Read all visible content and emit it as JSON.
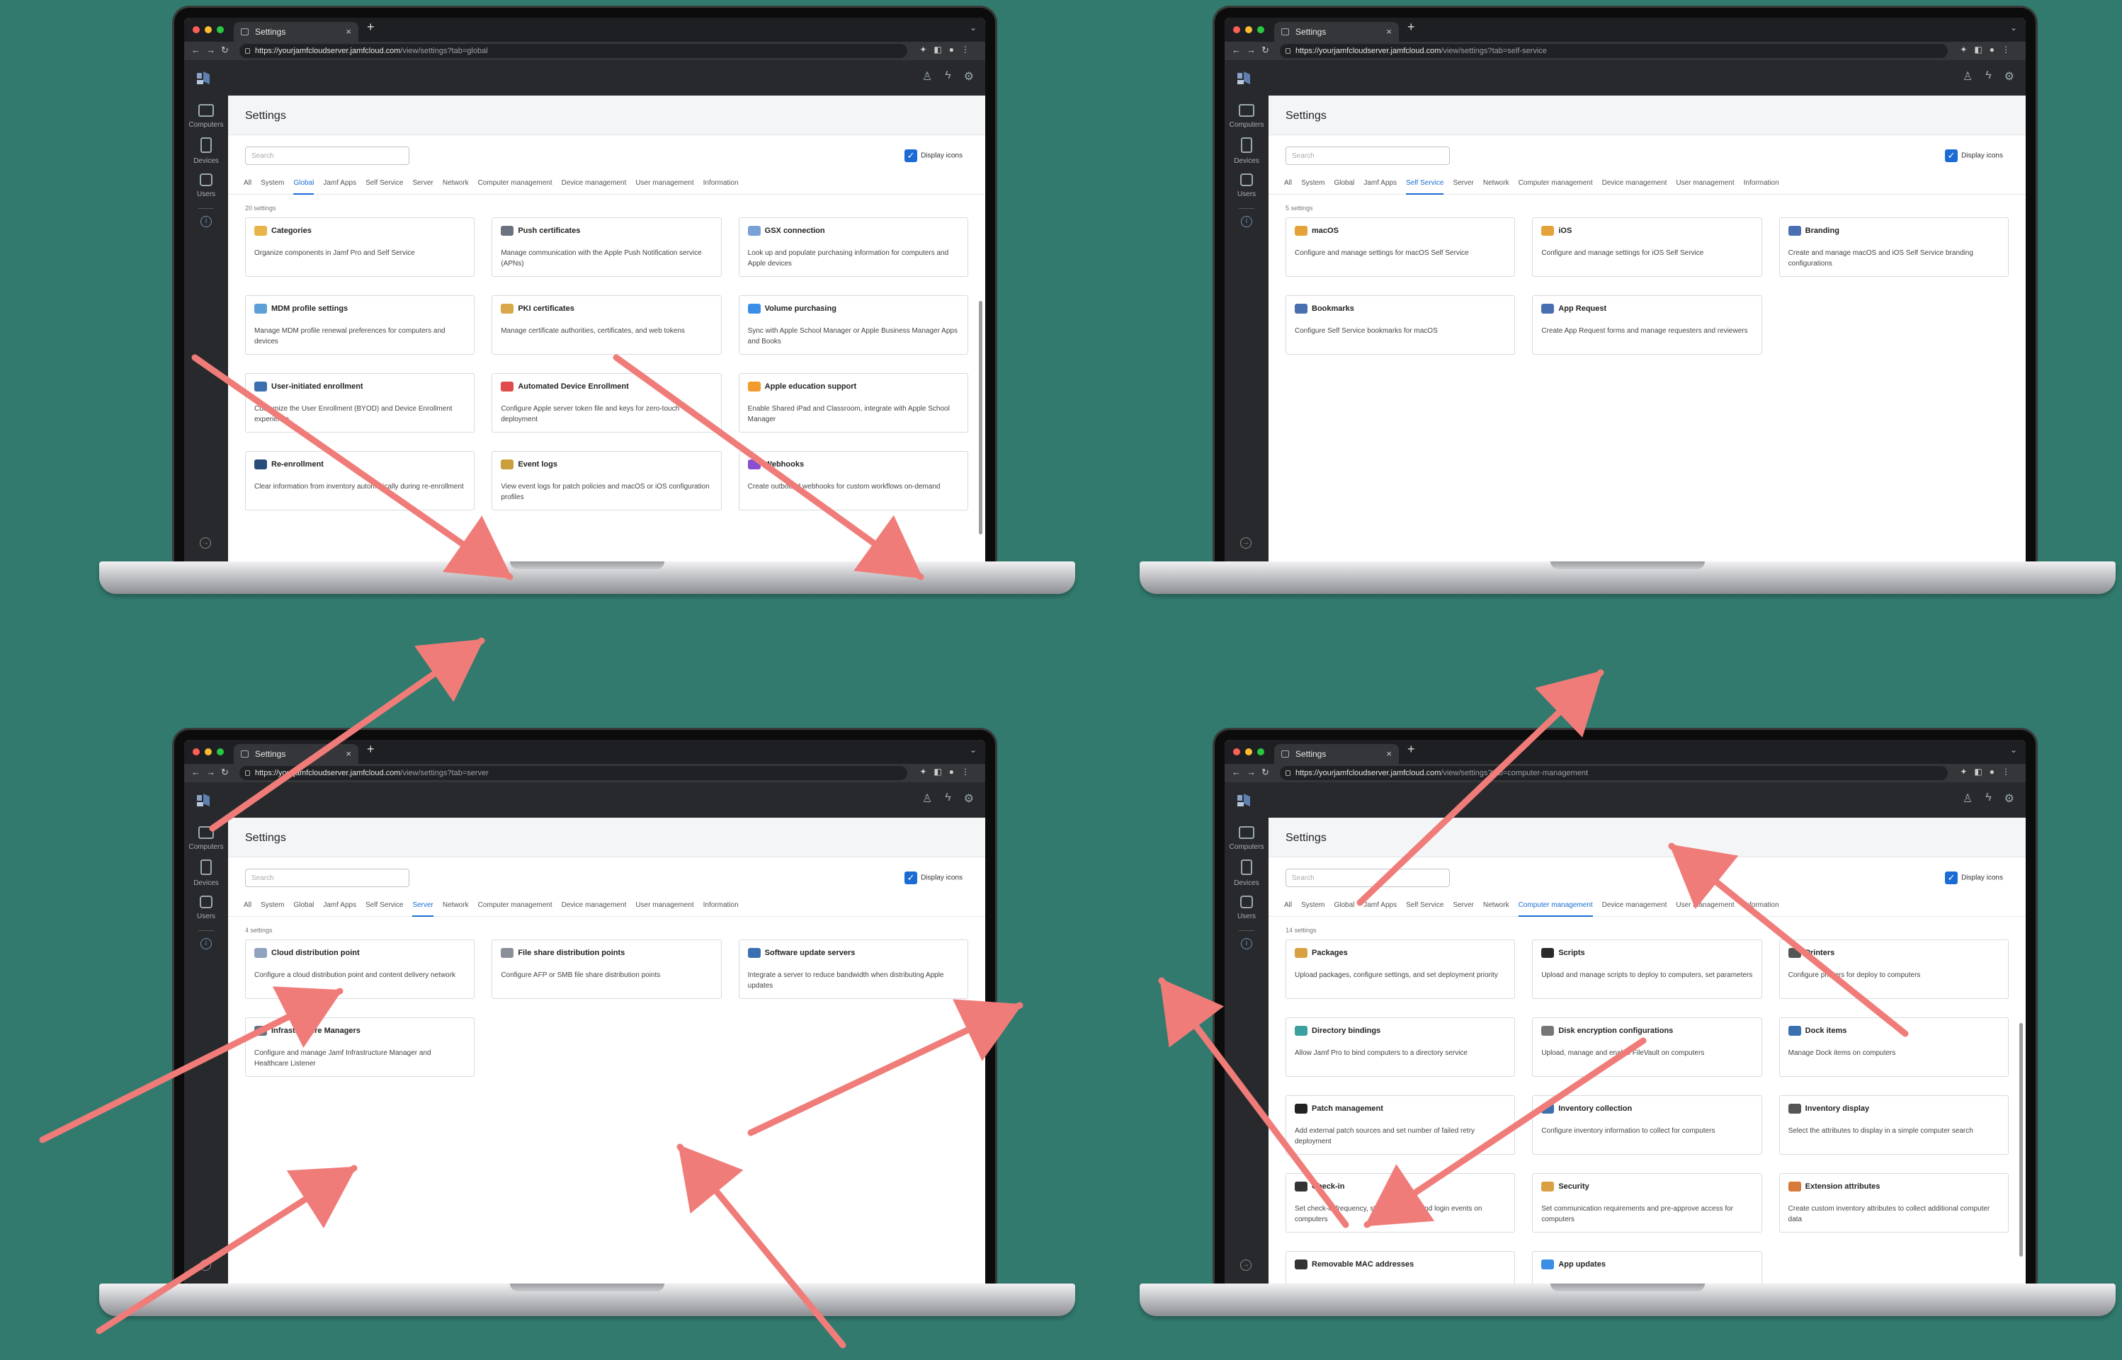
{
  "colors": {
    "background": "#327a6e",
    "accent": "#1a6cd3",
    "arrow": "#f07c79"
  },
  "screens": [
    {
      "id": "tl",
      "browser": {
        "tab_title": "Settings",
        "url_host": "https://yourjamfcloudserver.jamfcloud.com",
        "url_path": "/view/settings?tab=global"
      },
      "page_title": "Settings",
      "search_placeholder": "Search",
      "display_icons_label": "Display icons",
      "tabs": [
        "All",
        "System",
        "Global",
        "Jamf Apps",
        "Self Service",
        "Server",
        "Network",
        "Computer management",
        "Device management",
        "User management",
        "Information"
      ],
      "active_tab": "Global",
      "count": "20 settings",
      "cards": [
        {
          "title": "Categories",
          "desc": "Organize components in Jamf Pro and Self Service",
          "icon": "folder-icon",
          "color": "#e8b449"
        },
        {
          "title": "Push certificates",
          "desc": "Manage communication with the Apple Push Notification service (APNs)",
          "icon": "push-certificate-icon",
          "color": "#6b7280"
        },
        {
          "title": "GSX connection",
          "desc": "Look up and populate purchasing information for computers and Apple devices",
          "icon": "gsx-icon",
          "color": "#7aa0d8"
        },
        {
          "title": "MDM profile settings",
          "desc": "Manage MDM profile renewal preferences for computers and devices",
          "icon": "mdm-profile-icon",
          "color": "#5da0d8"
        },
        {
          "title": "PKI certificates",
          "desc": "Manage certificate authorities, certificates, and web tokens",
          "icon": "certificate-icon",
          "color": "#d8a84a"
        },
        {
          "title": "Volume purchasing",
          "desc": "Sync with Apple School Manager or Apple Business Manager Apps and Books",
          "icon": "app-store-icon",
          "color": "#3a8ee6"
        },
        {
          "title": "User-initiated enrollment",
          "desc": "Customize the User Enrollment (BYOD) and Device Enrollment experience",
          "icon": "enrollment-icon",
          "color": "#3a6fb0"
        },
        {
          "title": "Automated Device Enrollment",
          "desc": "Configure Apple server token file and keys for zero-touch deployment",
          "icon": "device-enrollment-icon",
          "color": "#e04b4b"
        },
        {
          "title": "Apple education support",
          "desc": "Enable Shared iPad and Classroom, integrate with Apple School Manager",
          "icon": "education-icon",
          "color": "#f29a2e"
        },
        {
          "title": "Re-enrollment",
          "desc": "Clear information from inventory automatically during re-enrollment",
          "icon": "re-enrollment-icon",
          "color": "#2a4c7a"
        },
        {
          "title": "Event logs",
          "desc": "View event logs for patch policies and macOS or iOS configuration profiles",
          "icon": "event-log-icon",
          "color": "#c99e3b"
        },
        {
          "title": "Webhooks",
          "desc": "Create outbound webhooks for custom workflows on-demand",
          "icon": "webhook-icon",
          "color": "#8a4fd0"
        }
      ]
    },
    {
      "id": "tr",
      "browser": {
        "tab_title": "Settings",
        "url_host": "https://yourjamfcloudserver.jamfcloud.com",
        "url_path": "/view/settings?tab=self-service"
      },
      "page_title": "Settings",
      "search_placeholder": "Search",
      "display_icons_label": "Display icons",
      "tabs": [
        "All",
        "System",
        "Global",
        "Jamf Apps",
        "Self Service",
        "Server",
        "Network",
        "Computer management",
        "Device management",
        "User management",
        "Information"
      ],
      "active_tab": "Self Service",
      "count": "5 settings",
      "cards": [
        {
          "title": "macOS",
          "desc": "Configure and manage settings for macOS Self Service",
          "icon": "macos-self-service-icon",
          "color": "#e6a23a"
        },
        {
          "title": "iOS",
          "desc": "Configure and manage settings for iOS Self Service",
          "icon": "ios-self-service-icon",
          "color": "#e6a23a"
        },
        {
          "title": "Branding",
          "desc": "Create and manage macOS and iOS Self Service branding configurations",
          "icon": "branding-icon",
          "color": "#4a6fb0"
        },
        {
          "title": "Bookmarks",
          "desc": "Configure Self Service bookmarks for macOS",
          "icon": "bookmark-icon",
          "color": "#4a6fb0"
        },
        {
          "title": "App Request",
          "desc": "Create App Request forms and manage requesters and reviewers",
          "icon": "app-request-icon",
          "color": "#4a6fb0"
        }
      ]
    },
    {
      "id": "bl",
      "browser": {
        "tab_title": "Settings",
        "url_host": "https://yourjamfcloudserver.jamfcloud.com",
        "url_path": "/view/settings?tab=server"
      },
      "page_title": "Settings",
      "search_placeholder": "Search",
      "display_icons_label": "Display icons",
      "tabs": [
        "All",
        "System",
        "Global",
        "Jamf Apps",
        "Self Service",
        "Server",
        "Network",
        "Computer management",
        "Device management",
        "User management",
        "Information"
      ],
      "active_tab": "Server",
      "count": "4 settings",
      "cards": [
        {
          "title": "Cloud distribution point",
          "desc": "Configure a cloud distribution point and content delivery network",
          "icon": "cloud-icon",
          "color": "#8fa3bf"
        },
        {
          "title": "File share distribution points",
          "desc": "Configure AFP or SMB file share distribution points",
          "icon": "file-share-icon",
          "color": "#8a8f99"
        },
        {
          "title": "Software update servers",
          "desc": "Integrate a server to reduce bandwidth when distributing Apple updates",
          "icon": "software-update-icon",
          "color": "#3a6fb0"
        },
        {
          "title": "Infrastructure Managers",
          "desc": "Configure and manage Jamf Infrastructure Manager and Healthcare Listener",
          "icon": "infrastructure-icon",
          "color": "#6b7280"
        }
      ]
    },
    {
      "id": "br",
      "browser": {
        "tab_title": "Settings",
        "url_host": "https://yourjamfcloudserver.jamfcloud.com",
        "url_path": "/view/settings?tab=computer-management"
      },
      "page_title": "Settings",
      "search_placeholder": "Search",
      "display_icons_label": "Display icons",
      "tabs": [
        "All",
        "System",
        "Global",
        "Jamf Apps",
        "Self Service",
        "Server",
        "Network",
        "Computer management",
        "Device management",
        "User management",
        "Information"
      ],
      "active_tab": "Computer management",
      "count": "14 settings",
      "cards": [
        {
          "title": "Packages",
          "desc": "Upload packages, configure settings, and set deployment priority",
          "icon": "package-icon",
          "color": "#d8a040"
        },
        {
          "title": "Scripts",
          "desc": "Upload and manage scripts to deploy to computers, set parameters",
          "icon": "script-icon",
          "color": "#2a2a2a"
        },
        {
          "title": "Printers",
          "desc": "Configure printers for deploy to computers",
          "icon": "printer-icon",
          "color": "#555"
        },
        {
          "title": "Directory bindings",
          "desc": "Allow Jamf Pro to bind computers to a directory service",
          "icon": "directory-icon",
          "color": "#3aa0a0"
        },
        {
          "title": "Disk encryption configurations",
          "desc": "Upload, manage and enable FileVault on computers",
          "icon": "disk-encryption-icon",
          "color": "#777"
        },
        {
          "title": "Dock items",
          "desc": "Manage Dock items on computers",
          "icon": "dock-icon",
          "color": "#3a6fb0"
        },
        {
          "title": "Patch management",
          "desc": "Add external patch sources and set number of failed retry deployment",
          "icon": "patch-icon",
          "color": "#222"
        },
        {
          "title": "Inventory collection",
          "desc": "Configure inventory information to collect for computers",
          "icon": "inventory-collection-icon",
          "color": "#3a6fb0"
        },
        {
          "title": "Inventory display",
          "desc": "Select the attributes to display in a simple computer search",
          "icon": "inventory-display-icon",
          "color": "#555"
        },
        {
          "title": "Check-in",
          "desc": "Set check-in frequency, startup options, and login events on computers",
          "icon": "check-in-icon",
          "color": "#333"
        },
        {
          "title": "Security",
          "desc": "Set communication requirements and pre-approve access for computers",
          "icon": "lock-icon",
          "color": "#d8a040"
        },
        {
          "title": "Extension attributes",
          "desc": "Create custom inventory attributes to collect additional computer data",
          "icon": "extension-attribute-icon",
          "color": "#d87a3a"
        },
        {
          "title": "Removable MAC addresses",
          "desc": "",
          "icon": "mac-address-icon",
          "color": "#333"
        },
        {
          "title": "App updates",
          "desc": "",
          "icon": "app-update-icon",
          "color": "#3a8ee6"
        }
      ]
    }
  ],
  "sidebar": {
    "computers": "Computers",
    "devices": "Devices",
    "users": "Users"
  }
}
